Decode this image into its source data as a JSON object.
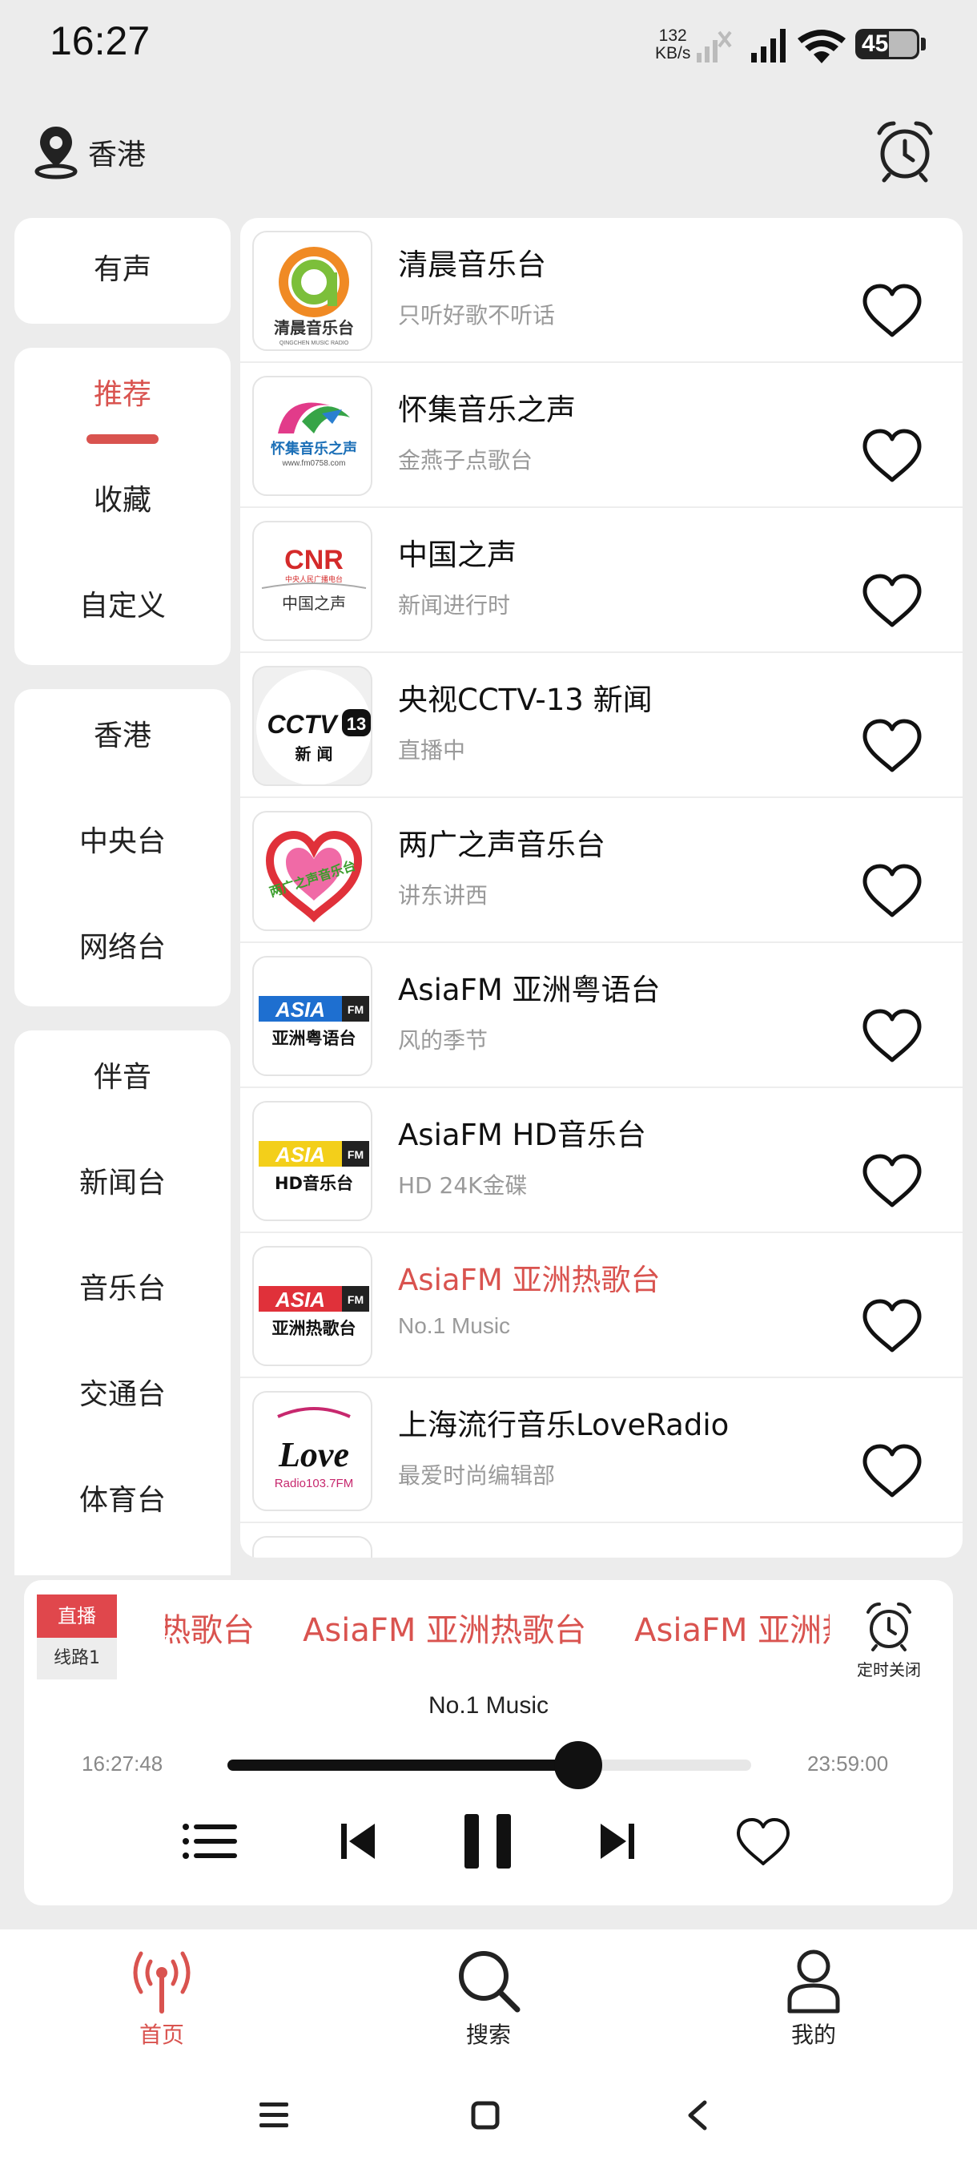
{
  "status_bar": {
    "time": "16:27",
    "net_speed_value": "132",
    "net_speed_unit": "KB/s",
    "battery": "45"
  },
  "header": {
    "location": "香港",
    "icons": [
      "location-pin-icon",
      "alarm-clock-icon"
    ]
  },
  "sidebar": {
    "group1": [
      "有声"
    ],
    "group2": [
      "推荐",
      "收藏",
      "自定义"
    ],
    "group3": [
      "香港",
      "中央台",
      "网络台"
    ],
    "group4": [
      "伴音",
      "新闻台",
      "音乐台",
      "交通台",
      "体育台"
    ],
    "active": "推荐"
  },
  "stations": [
    {
      "title": "清晨音乐台",
      "subtitle": "只听好歌不听话",
      "logo_text": "清晨音乐台",
      "logo_sub": "QINGCHEN MUSIC RADIO"
    },
    {
      "title": "怀集音乐之声",
      "subtitle": "金燕子点歌台",
      "logo_text": "怀集音乐之声",
      "logo_sub": "www.fm0758.com"
    },
    {
      "title": "中国之声",
      "subtitle": "新闻进行时",
      "logo_text": "CNR",
      "logo_mid": "中央人民广播电台",
      "logo_sub": "中国之声"
    },
    {
      "title": "央视CCTV-13 新闻",
      "subtitle": "直播中",
      "logo_text": "CCTV",
      "logo_num": "13",
      "logo_sub": "新 闻"
    },
    {
      "title": "两广之声音乐台",
      "subtitle": "讲东讲西",
      "logo_text": "两广之声音乐台"
    },
    {
      "title": "AsiaFM 亚洲粤语台",
      "subtitle": "风的季节",
      "logo_text": "ASIA",
      "logo_fm": "FM",
      "logo_sub": "亚洲粤语台"
    },
    {
      "title": "AsiaFM HD音乐台",
      "subtitle": "HD 24K金碟",
      "logo_text": "ASIA",
      "logo_fm": "FM",
      "logo_sub": "HD音乐台"
    },
    {
      "title": "AsiaFM 亚洲热歌台",
      "subtitle": "No.1 Music",
      "logo_text": "ASIA",
      "logo_fm": "FM",
      "logo_sub": "亚洲热歌台"
    },
    {
      "title": "上海流行音乐LoveRadio",
      "subtitle": "最爱时尚编辑部",
      "logo_text": "Love",
      "logo_sub": "Radio103.7FM"
    }
  ],
  "playing_index": 7,
  "player": {
    "live_label": "直播",
    "line_label": "线路1",
    "marquee": [
      "AsiaFM 亚洲热歌台",
      "AsiaFM 亚洲热歌台",
      "AsiaFM 亚洲热歌台"
    ],
    "subtitle": "No.1 Music",
    "start_time": "16:27:48",
    "end_time": "23:59:00",
    "progress": 0.67,
    "timer_label": "定时关闭"
  },
  "bottom_nav": [
    {
      "label": "首页",
      "icon": "radio-antenna-icon",
      "active": true
    },
    {
      "label": "搜索",
      "icon": "search-icon",
      "active": false
    },
    {
      "label": "我的",
      "icon": "user-icon",
      "active": false
    }
  ],
  "colors": {
    "accent": "#d9534f",
    "background": "#ececec",
    "card": "#ffffff",
    "muted_text": "#9a9a9a"
  }
}
